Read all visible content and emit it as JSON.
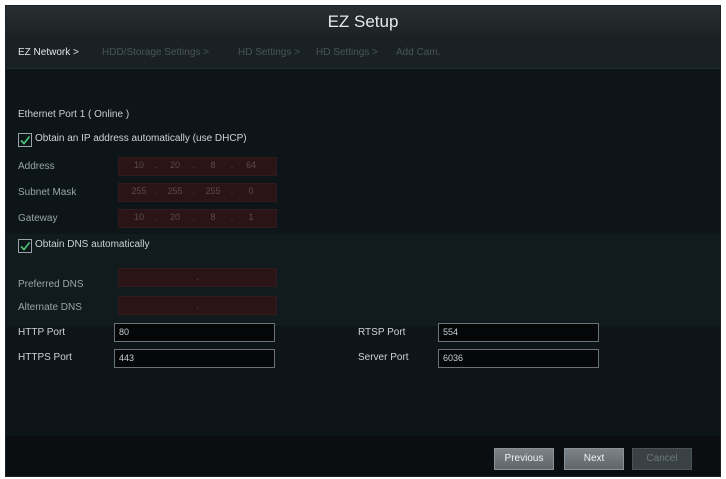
{
  "window": {
    "title": "EZ Setup"
  },
  "steps": [
    {
      "label": "EZ Network >",
      "active": true
    },
    {
      "label": "HDD/Storage Settings >",
      "active": false
    },
    {
      "label": "HD Settings >",
      "active": false
    },
    {
      "label": "HD Settings >",
      "active": false
    },
    {
      "label": "Add Cam.",
      "active": false
    }
  ],
  "network": {
    "section_title": "Ethernet Port 1 ( Online )",
    "dhcp_label": "Obtain an IP address automatically (use DHCP)",
    "dhcp_checked": true,
    "address": {
      "label": "Address",
      "octets": [
        "10",
        "20",
        "8",
        "64"
      ]
    },
    "subnet": {
      "label": "Subnet Mask",
      "octets": [
        "255",
        "255",
        "255",
        "0"
      ]
    },
    "gateway": {
      "label": "Gateway",
      "octets": [
        "10",
        "20",
        "8",
        "1"
      ]
    },
    "dot": "."
  },
  "dns": {
    "auto_label": "Obtain DNS automatically",
    "auto_checked": true,
    "preferred": {
      "label": "Preferred DNS",
      "value": "."
    },
    "alternate": {
      "label": "Alternate DNS",
      "value": "."
    }
  },
  "ports": {
    "http": {
      "label": "HTTP Port",
      "value": "80"
    },
    "https": {
      "label": "HTTPS Port",
      "value": "443"
    },
    "rtsp": {
      "label": "RTSP Port",
      "value": "554"
    },
    "server": {
      "label": "Server Port",
      "value": "6036"
    }
  },
  "buttons": {
    "previous": "Previous",
    "next": "Next",
    "cancel": "Cancel"
  }
}
